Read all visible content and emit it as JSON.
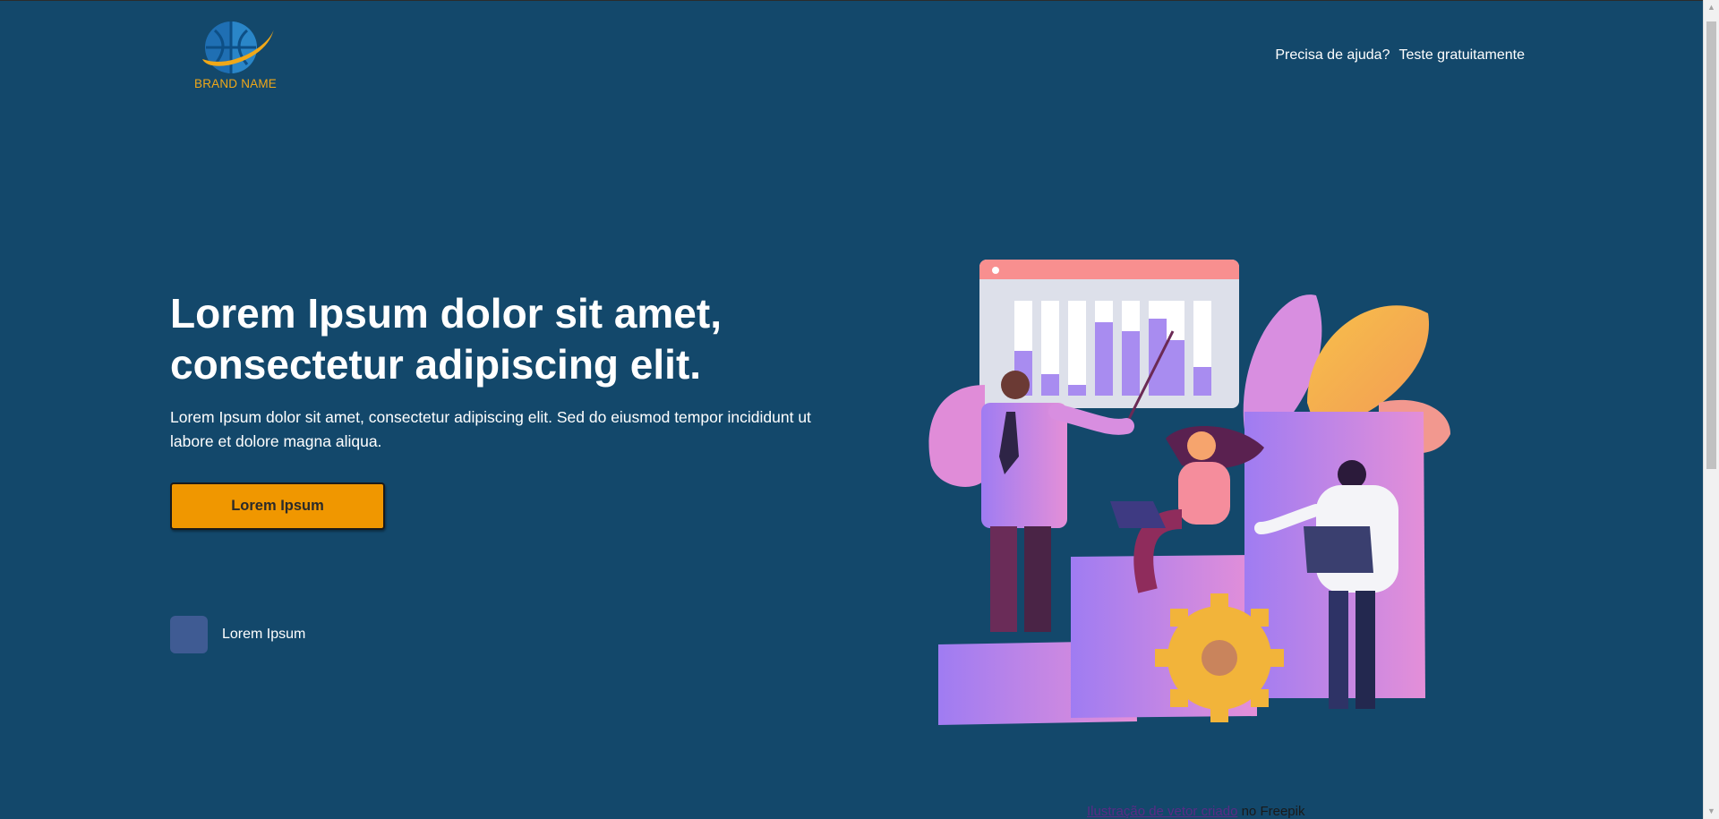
{
  "header": {
    "brand_name": "BRAND NAME",
    "nav": [
      {
        "label": "Precisa de ajuda?"
      },
      {
        "label": "Teste gratuitamente"
      }
    ]
  },
  "hero": {
    "title_line1": "Lorem Ipsum dolor sit amet,",
    "title_line2": "consectetur adipiscing elit.",
    "subtitle": "Lorem Ipsum dolor sit amet, consectetur adipiscing elit. Sed do eiusmod tempor incididunt ut labore et dolore magna aliqua.",
    "cta_label": "Lorem Ipsum",
    "feature_label": "Lorem Ipsum"
  },
  "footer": {
    "credit_link": "Ilustração de vetor criado",
    "credit_suffix": "no Freepik"
  },
  "colors": {
    "background": "#13486b",
    "accent": "#f09700",
    "badge": "#3f5b93",
    "brand": "#f0a818"
  }
}
